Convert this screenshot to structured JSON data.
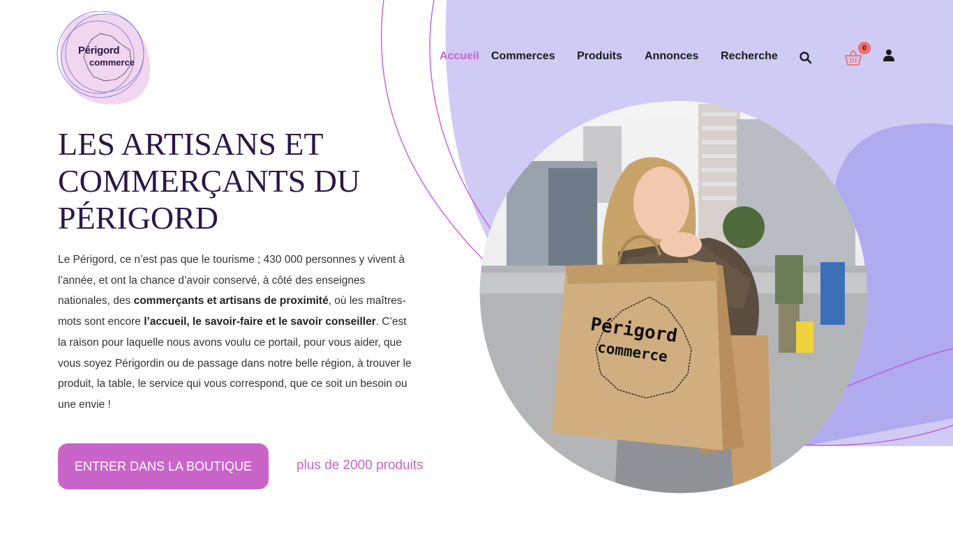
{
  "logo": {
    "line1": "Périgord",
    "line2": "commerce"
  },
  "nav": {
    "items": [
      {
        "label": "Accueil",
        "active": true
      },
      {
        "label": "Commerces",
        "active": false
      },
      {
        "label": "Produits",
        "active": false
      },
      {
        "label": "Annonces",
        "active": false
      },
      {
        "label": "Recherche",
        "active": false
      }
    ],
    "cart_count": "0",
    "icons": [
      "search-icon",
      "basket-icon",
      "user-icon"
    ]
  },
  "hero": {
    "title_line1": "LES ARTISANS ET",
    "title_line2": "COMMERÇANTS DU",
    "title_line3": "PÉRIGORD",
    "p1": "Le Périgord, ce n’est pas que le tourisme ; 430 000 personnes y vivent à l’année, et ont la chance d’avoir conservé, à côté des enseignes nationales, des ",
    "p1_bold": "commerçants et artisans de proximité",
    "p2": ", où les maîtres-mots sont encore ",
    "p2_bold": "l’accueil, le savoir-faire et le savoir conseiller",
    "p3": ". C’est la raison pour laquelle nous avons voulu ce portail, pour vous aider, que vous soyez Périgordin ou de passage dans notre belle région, à trouver le produit, la table, le service qui vous correspond, que ce soit un besoin ou une envie !",
    "cta_label": "ENTRER DANS LA BOUTIQUE",
    "cta_sub": "plus de 2000 produits"
  },
  "photo": {
    "bag_line1": "Périgord",
    "bag_line2": "commerce"
  },
  "colors": {
    "accent": "#c965c9",
    "lavender": "#cfcbf5",
    "title": "#2a1747",
    "badge": "#ef6f6f"
  }
}
